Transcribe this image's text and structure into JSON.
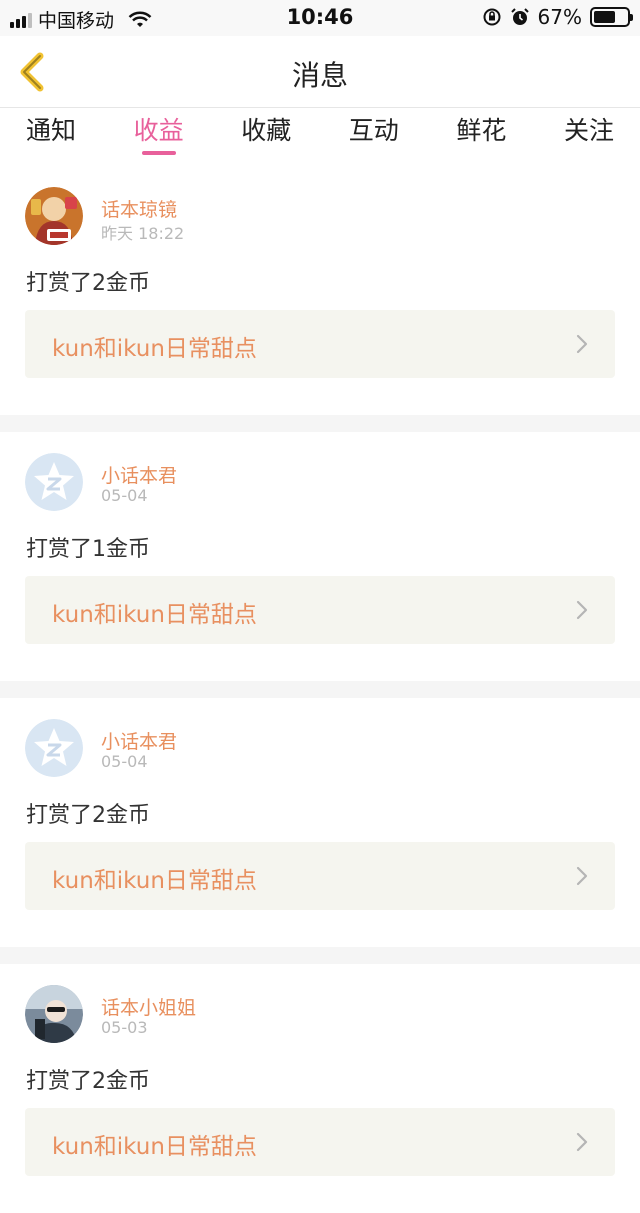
{
  "status_bar": {
    "carrier": "中国移动",
    "time": "10:46",
    "battery_percent_label": "67%",
    "battery_level": 0.67
  },
  "header": {
    "title": "消息"
  },
  "tabs": [
    {
      "label": "通知",
      "active": false
    },
    {
      "label": "收益",
      "active": true
    },
    {
      "label": "收藏",
      "active": false
    },
    {
      "label": "互动",
      "active": false
    },
    {
      "label": "鲜花",
      "active": false
    },
    {
      "label": "关注",
      "active": false
    }
  ],
  "messages": [
    {
      "avatar": "photo-avatar",
      "name": "话本琼镜",
      "time": "昨天 18:22",
      "text": "打赏了2金币",
      "work_title": "kun和ikun日常甜点"
    },
    {
      "avatar": "default-avatar",
      "name": "小话本君",
      "time": "05-04",
      "text": "打赏了1金币",
      "work_title": "kun和ikun日常甜点"
    },
    {
      "avatar": "default-avatar",
      "name": "小话本君",
      "time": "05-04",
      "text": "打赏了2金币",
      "work_title": "kun和ikun日常甜点"
    },
    {
      "avatar": "photo-avatar",
      "name": "话本小姐姐",
      "time": "05-03",
      "text": "打赏了2金币",
      "work_title": "kun和ikun日常甜点"
    }
  ],
  "colors": {
    "accent": "#e8609b",
    "name": "#e8905f",
    "work_bg": "#f5f5ef",
    "back_icon": "#f1c232"
  }
}
